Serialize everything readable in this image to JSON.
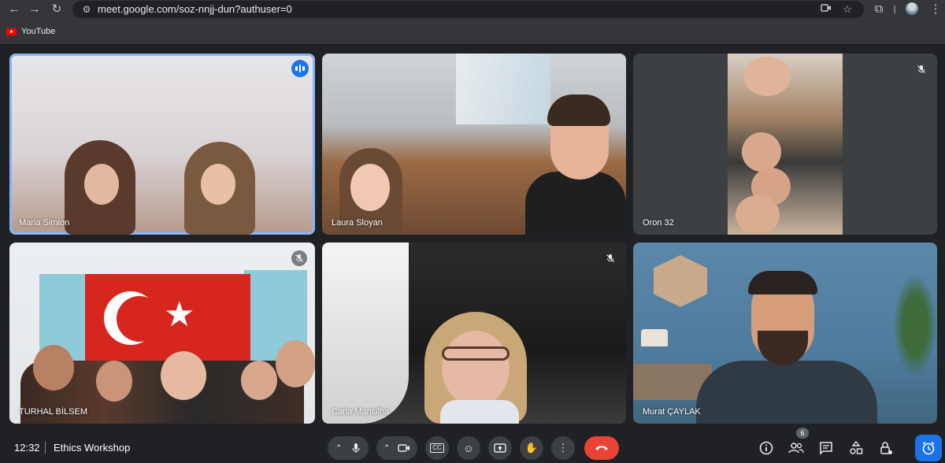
{
  "browser": {
    "url": "meet.google.com/soz-nnjj-dun?authuser=0",
    "bookmarks": [
      {
        "label": "YouTube",
        "icon": "youtube-icon"
      }
    ],
    "toolbar_icons": [
      "back-icon",
      "forward-icon",
      "reload-icon",
      "site-settings-icon",
      "camera-icon",
      "star-icon",
      "extensions-icon",
      "profile-avatar",
      "menu-icon"
    ]
  },
  "participants": [
    {
      "name": "Maria Simion",
      "status": "speaking",
      "active": true
    },
    {
      "name": "Laura Sloyan",
      "status": "none"
    },
    {
      "name": "Oron 32",
      "status": "muted"
    },
    {
      "name": "TURHAL BİLSEM",
      "status": "muted"
    },
    {
      "name": "Carla Mansilha",
      "status": "muted"
    },
    {
      "name": "Murat ÇAYLAK",
      "status": "none"
    }
  ],
  "bottom_bar": {
    "time": "12:32",
    "meeting_title": "Ethics Workshop",
    "participant_count": "6",
    "controls": [
      "mic-options-chevron",
      "mic-icon",
      "camera-options-chevron",
      "camera-icon",
      "captions-icon",
      "emoji-icon",
      "present-icon",
      "raise-hand-icon",
      "more-options-icon",
      "leave-call-icon"
    ],
    "side_icons": [
      "info-icon",
      "people-icon",
      "chat-icon",
      "activities-icon",
      "host-controls-icon",
      "timer-icon"
    ]
  },
  "colors": {
    "accent": "#1a73e8",
    "end_call": "#ea4335",
    "background": "#202124",
    "active_border": "#8ab4f8"
  }
}
